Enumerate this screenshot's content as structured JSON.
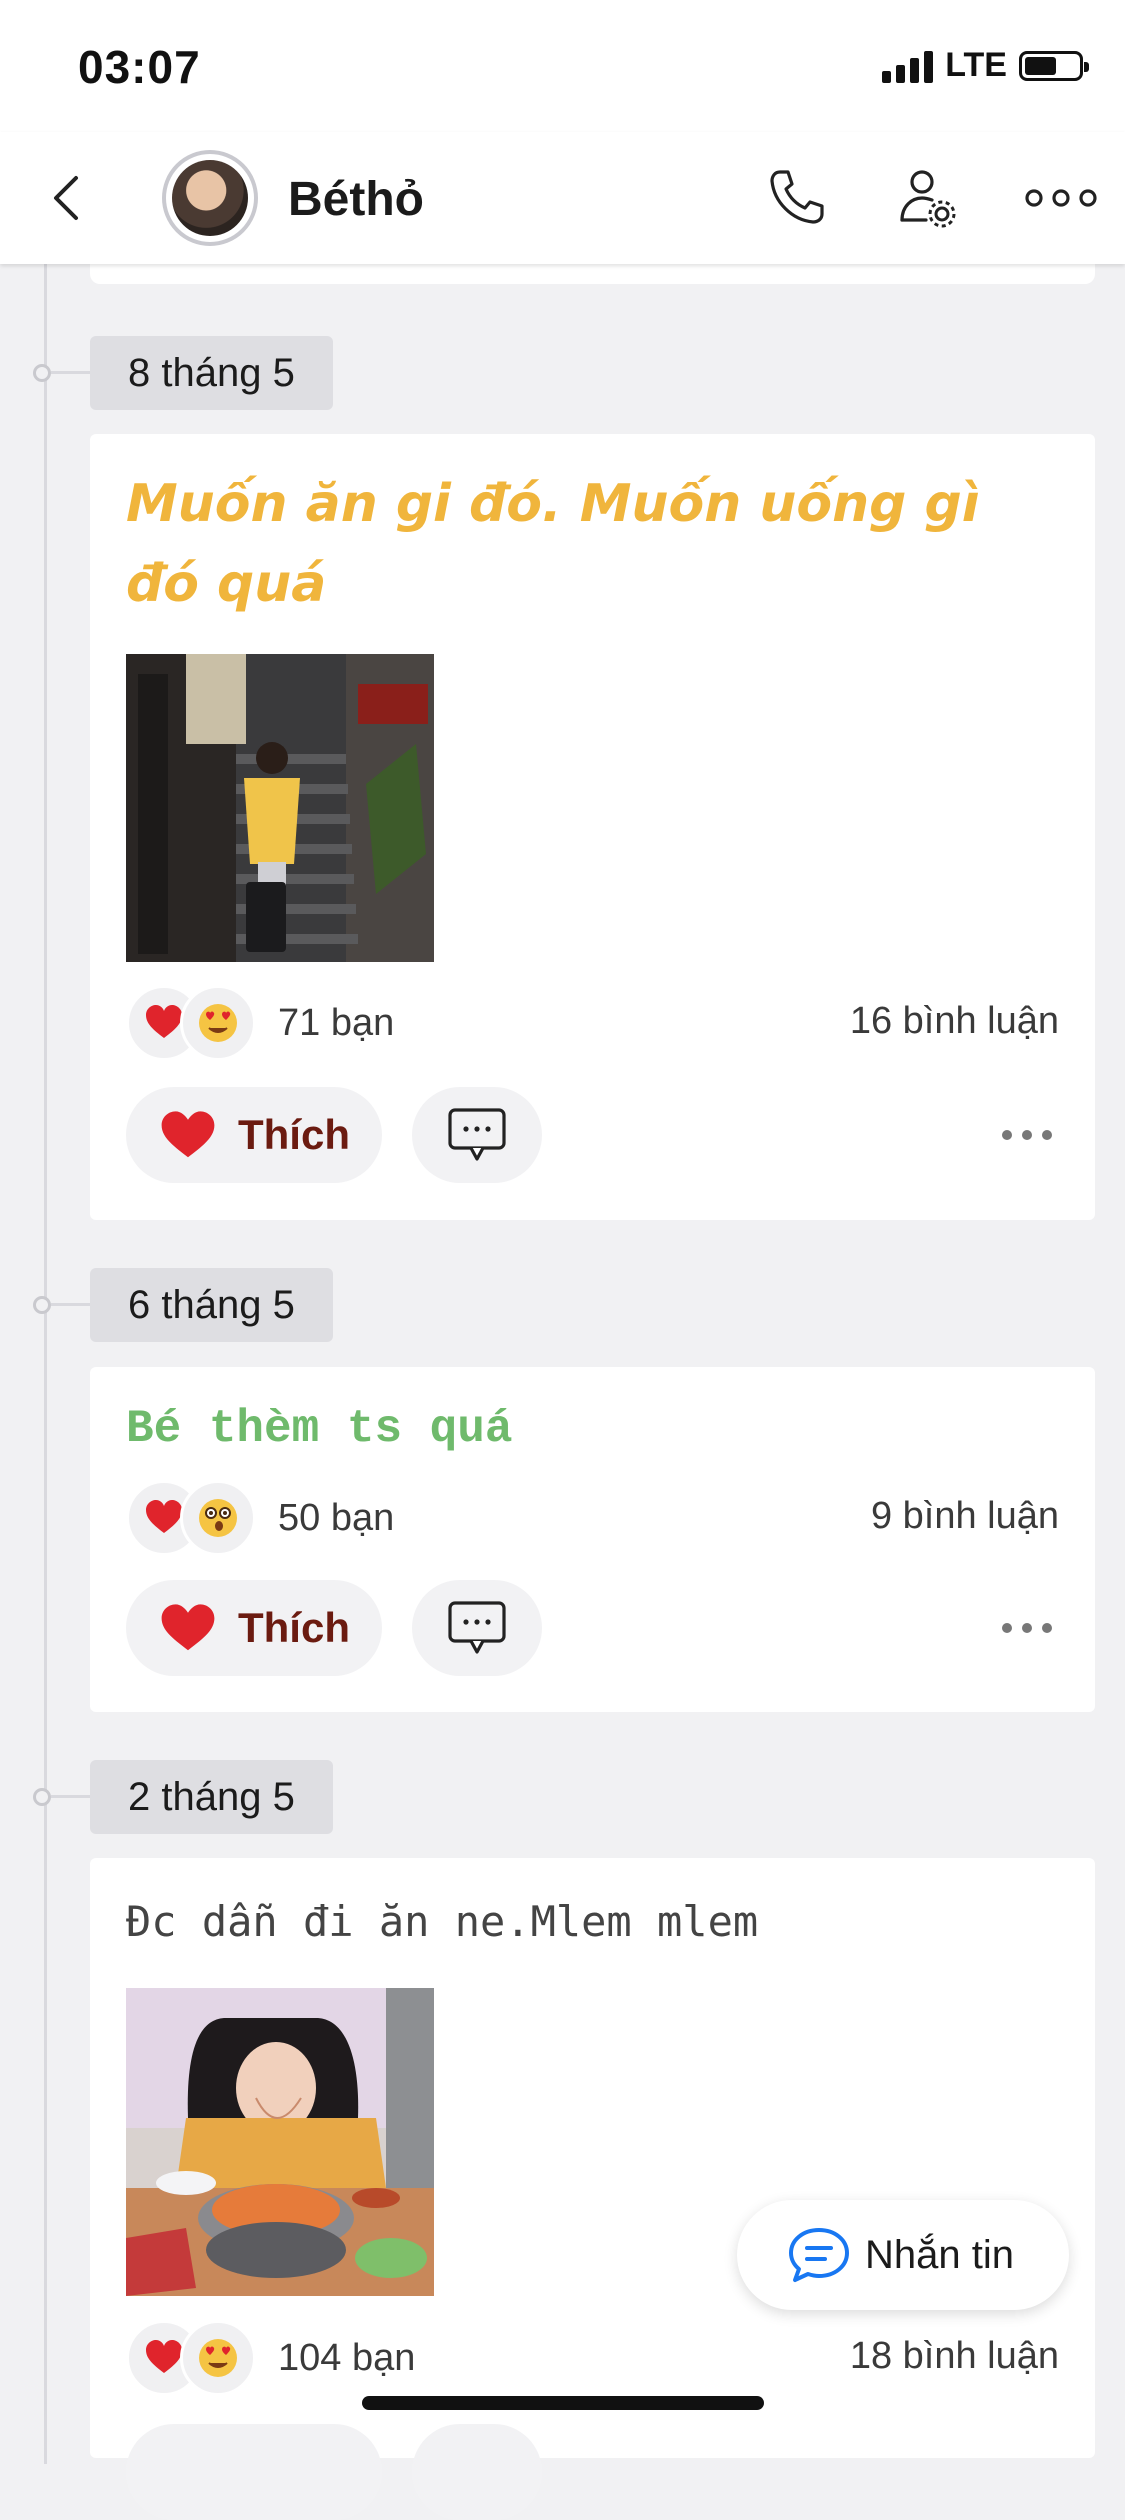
{
  "status_bar": {
    "time": "03:07",
    "network": "LTE",
    "battery_level": 0.6
  },
  "header": {
    "name": "Béthỏ",
    "back_icon": "chevron-left-icon",
    "call_icon": "phone-icon",
    "settings_icon": "user-gear-icon",
    "more_icon": "more-horizontal-icon"
  },
  "posts": [
    {
      "date": "8 tháng 5",
      "text": "Muốn ăn gi đó. Muốn uống gì đó quá",
      "text_color": "#f0b53c",
      "has_photo": true,
      "reactions": [
        "heart",
        "heart-eyes"
      ],
      "reaction_count": "71 bạn",
      "comments": "16 bình luận",
      "like_label": "Thích"
    },
    {
      "date": "6 tháng 5",
      "text": "Bé thèm ts quá",
      "text_color": "#6fba6c",
      "has_photo": false,
      "reactions": [
        "heart",
        "surprised"
      ],
      "reaction_count": "50 bạn",
      "comments": "9 bình luận",
      "like_label": "Thích"
    },
    {
      "date": "2 tháng 5",
      "text": "Đc dẫn đi ăn ne.Mlem mlem",
      "text_color": "#444444",
      "has_photo": true,
      "reactions": [
        "heart",
        "heart-eyes"
      ],
      "reaction_count": "104 bạn",
      "comments": "18 bình luận"
    }
  ],
  "message_button": {
    "label": "Nhắn tin",
    "icon": "chat-bubble-icon"
  },
  "colors": {
    "accent_blue": "#1877f2",
    "heart_red": "#e0242c",
    "like_text": "#6b1b10"
  }
}
